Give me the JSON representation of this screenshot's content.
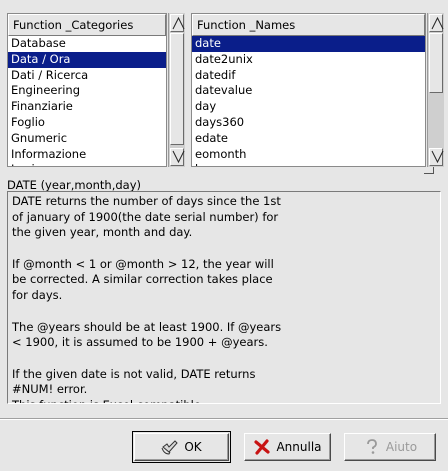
{
  "categories": {
    "header": "Function _Categories",
    "items": [
      "Database",
      "Data / Ora",
      "Dati / Ricerca",
      "Engineering",
      "Finanziarie",
      "Foglio",
      "Gnumeric",
      "Informazione",
      "Logica"
    ],
    "selected_index": 1
  },
  "names": {
    "header": "Function _Names",
    "items": [
      "date",
      "date2unix",
      "datedif",
      "datevalue",
      "day",
      "days360",
      "edate",
      "eomonth",
      "hour"
    ],
    "selected_index": 0
  },
  "signature": "DATE (year,month,day)",
  "description_lines": [
    "DATE returns the number of days since the 1st",
    "of january of 1900(the date serial number) for",
    "the given year, month and day.",
    "",
    "If @month < 1 or @month > 12, the year will",
    "be corrected. A similar correction takes place",
    "for days.",
    "",
    "The @years should be at least 1900. If @years",
    "< 1900, it is assumed to be 1900 + @years.",
    "",
    "If the given date is not valid, DATE returns",
    "#NUM! error.",
    "This function is Excel compatible."
  ],
  "buttons": {
    "ok": {
      "label": "OK",
      "icon": "check-icon"
    },
    "cancel": {
      "label": "Annulla",
      "icon": "x-icon"
    },
    "help": {
      "label": "Aiuto",
      "icon": "help-icon"
    }
  },
  "colors": {
    "selection": "#0a1e8a",
    "cancel_icon": "#c81414"
  }
}
